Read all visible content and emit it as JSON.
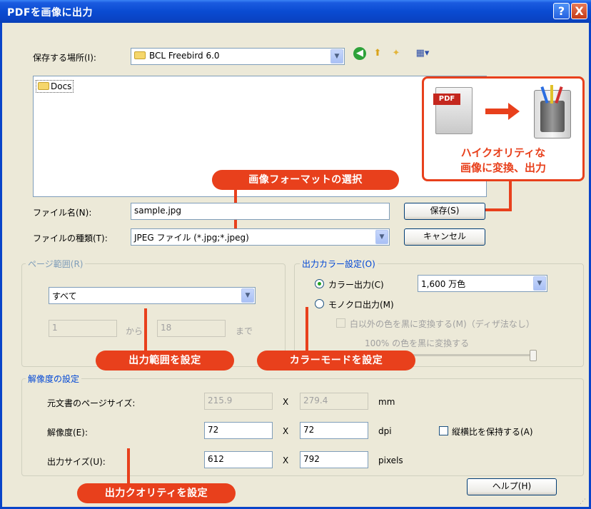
{
  "window": {
    "title": "PDFを画像に出力",
    "help_glyph": "?",
    "close_glyph": "X"
  },
  "save_location": {
    "label": "保存する場所(I):",
    "value": "BCL Freebird 6.0",
    "toolbar_icons": [
      "back-icon",
      "up-folder-icon",
      "new-folder-icon",
      "view-menu-icon"
    ]
  },
  "file_list": {
    "items": [
      "Docs"
    ]
  },
  "promo": {
    "pdf_label": "PDF",
    "text_line1": "ハイクオリティな",
    "text_line2": "画像に変換、出力"
  },
  "filename": {
    "label": "ファイル名(N):",
    "value": "sample.jpg",
    "save_button": "保存(S)"
  },
  "filetype": {
    "label": "ファイルの種類(T):",
    "value": "JPEG ファイル (*.jpg;*.jpeg)",
    "cancel_button": "キャンセル"
  },
  "page_range": {
    "legend": "ページ範囲(R)",
    "select_value": "すべて",
    "from_value": "1",
    "from_label": "から",
    "to_value": "18",
    "to_label": "まで"
  },
  "output_color": {
    "legend": "出力カラー設定(O)",
    "color_radio": "カラー出力(C)",
    "color_depth": "1,600 万色",
    "mono_radio": "モノクロ出力(M)",
    "mono_checkbox": "白以外の色を黒に変換する(M)（ディザ法なし）",
    "slider_label": "100% の色を黒に変換する"
  },
  "resolution": {
    "legend": "解像度の設定",
    "page_size_label": "元文書のページサイズ:",
    "page_width": "215.9",
    "page_height": "279.4",
    "page_unit": "mm",
    "dpi_label": "解像度(E):",
    "dpi_x": "72",
    "dpi_y": "72",
    "dpi_unit": "dpi",
    "keep_ratio": "縦横比を保持する(A)",
    "output_label": "出力サイズ(U):",
    "out_w": "612",
    "out_h": "792",
    "out_unit": "pixels",
    "times": "X"
  },
  "help_button": "ヘルプ(H)",
  "callouts": {
    "format": "画像フォーマットの選択",
    "range": "出力範囲を設定",
    "color": "カラーモードを設定",
    "quality": "出力クオリティを設定"
  },
  "colors": {
    "accent": "#e8401c",
    "titlebar": "#0a4bd2",
    "dialog_bg": "#ece9d8"
  }
}
